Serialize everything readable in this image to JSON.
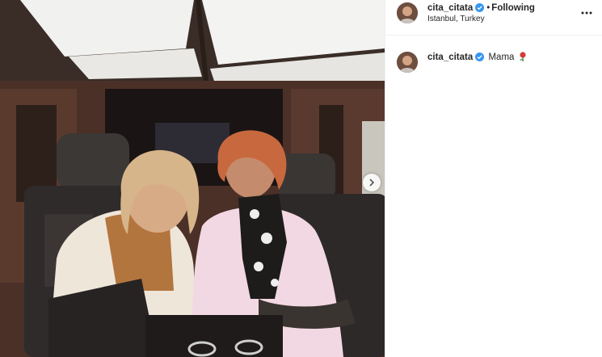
{
  "post": {
    "username": "cita_citata",
    "follow_state": "Following",
    "separator": "•",
    "location": "Istanbul, Turkey",
    "caption": "Mama",
    "caption_emoji": "rose-emoji",
    "icons": {
      "verified": "verified-badge-icon",
      "more": "more-options-icon",
      "next": "chevron-right-icon"
    },
    "colors": {
      "verified": "#3897f0",
      "divider": "#efefef",
      "text": "#262626"
    }
  }
}
